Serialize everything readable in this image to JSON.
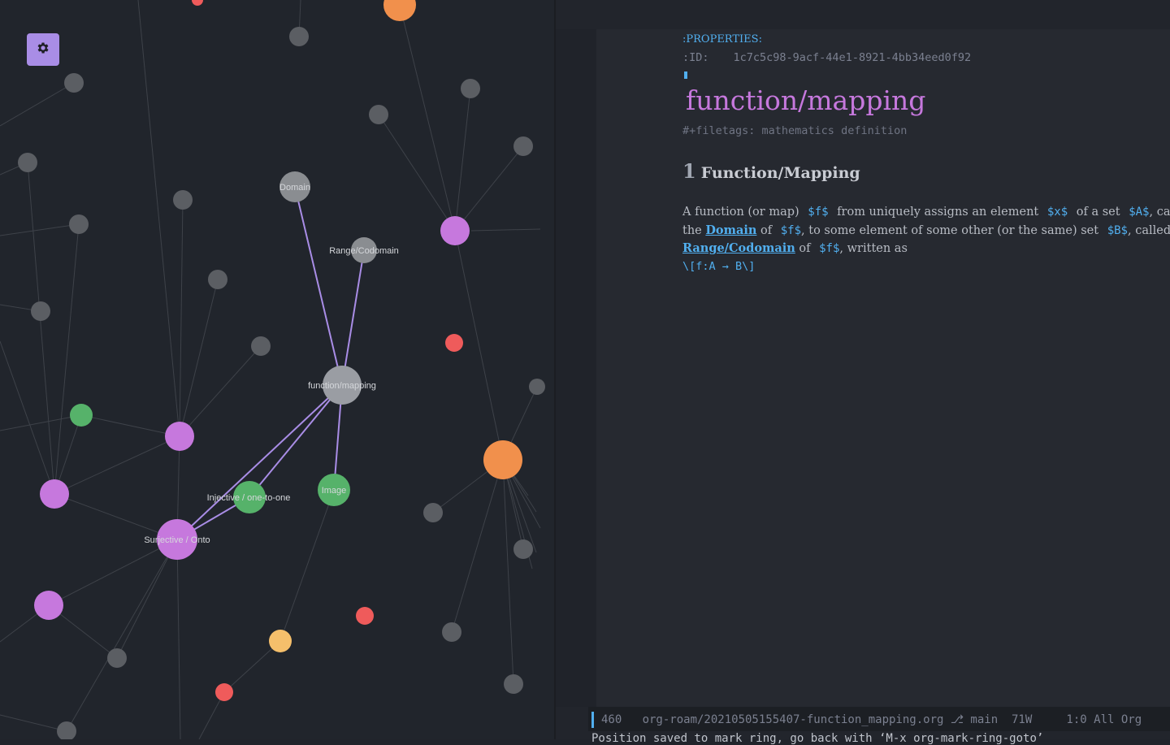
{
  "graph": {
    "settings_icon": "gear-icon",
    "colors": {
      "background": "#21252c",
      "edge": "#3e4249",
      "edge_highlight": "#a98de6",
      "node_gray": "#5b5e63",
      "node_gray_label": "#8a8d91",
      "node_center": "#9a9da3",
      "node_pink": "#c678dd",
      "node_green": "#56b26a",
      "node_orange": "#f1904c",
      "node_red": "#ef5b5b",
      "node_yellow": "#f5bf6b",
      "label": "#d5d7db"
    },
    "labeled_nodes": {
      "domain": "Domain",
      "range": "Range/Codomain",
      "center": "function/mapping",
      "injective": "Injective / one-to-one",
      "image": "Image",
      "surjective": "Surjective / Onto"
    }
  },
  "editor": {
    "properties_drawer": ":PROPERTIES:",
    "id_key": ":ID:",
    "id_value": "1c7c5c98-9acf-44e1-8921-4bb34eed0f92",
    "title": "function/mapping",
    "filetags": "#+filetags: mathematics definition",
    "heading_number": "1",
    "heading_text": "Function/Mapping",
    "para": {
      "l1_a": "A function (or map)",
      "l1_m1": "$f$",
      "l1_b": "from uniquely assigns an element",
      "l1_m2": "$x$",
      "l1_c": "of a set",
      "l1_m3": "$A$",
      "l1_d": ", ca",
      "l2_a": "the",
      "l2_link": "Domain",
      "l2_b": "of",
      "l2_m1": "$f$",
      "l2_c": ", to some element of some other (or the same) set",
      "l2_m2": "$B$",
      "l2_d": ", called",
      "l3_link": "Range/Codomain",
      "l3_a": "of",
      "l3_m1": "$f$",
      "l3_b": ", written as"
    },
    "latex": "\\[f:A → B\\]"
  },
  "modeline": {
    "text": "460   org-roam/20210505155407-function_mapping.org ⎇ main  71W     1:0 All Org"
  },
  "echo_area": {
    "text": "Position saved to mark ring, go back with ‘M-x org-mark-ring-goto’"
  }
}
